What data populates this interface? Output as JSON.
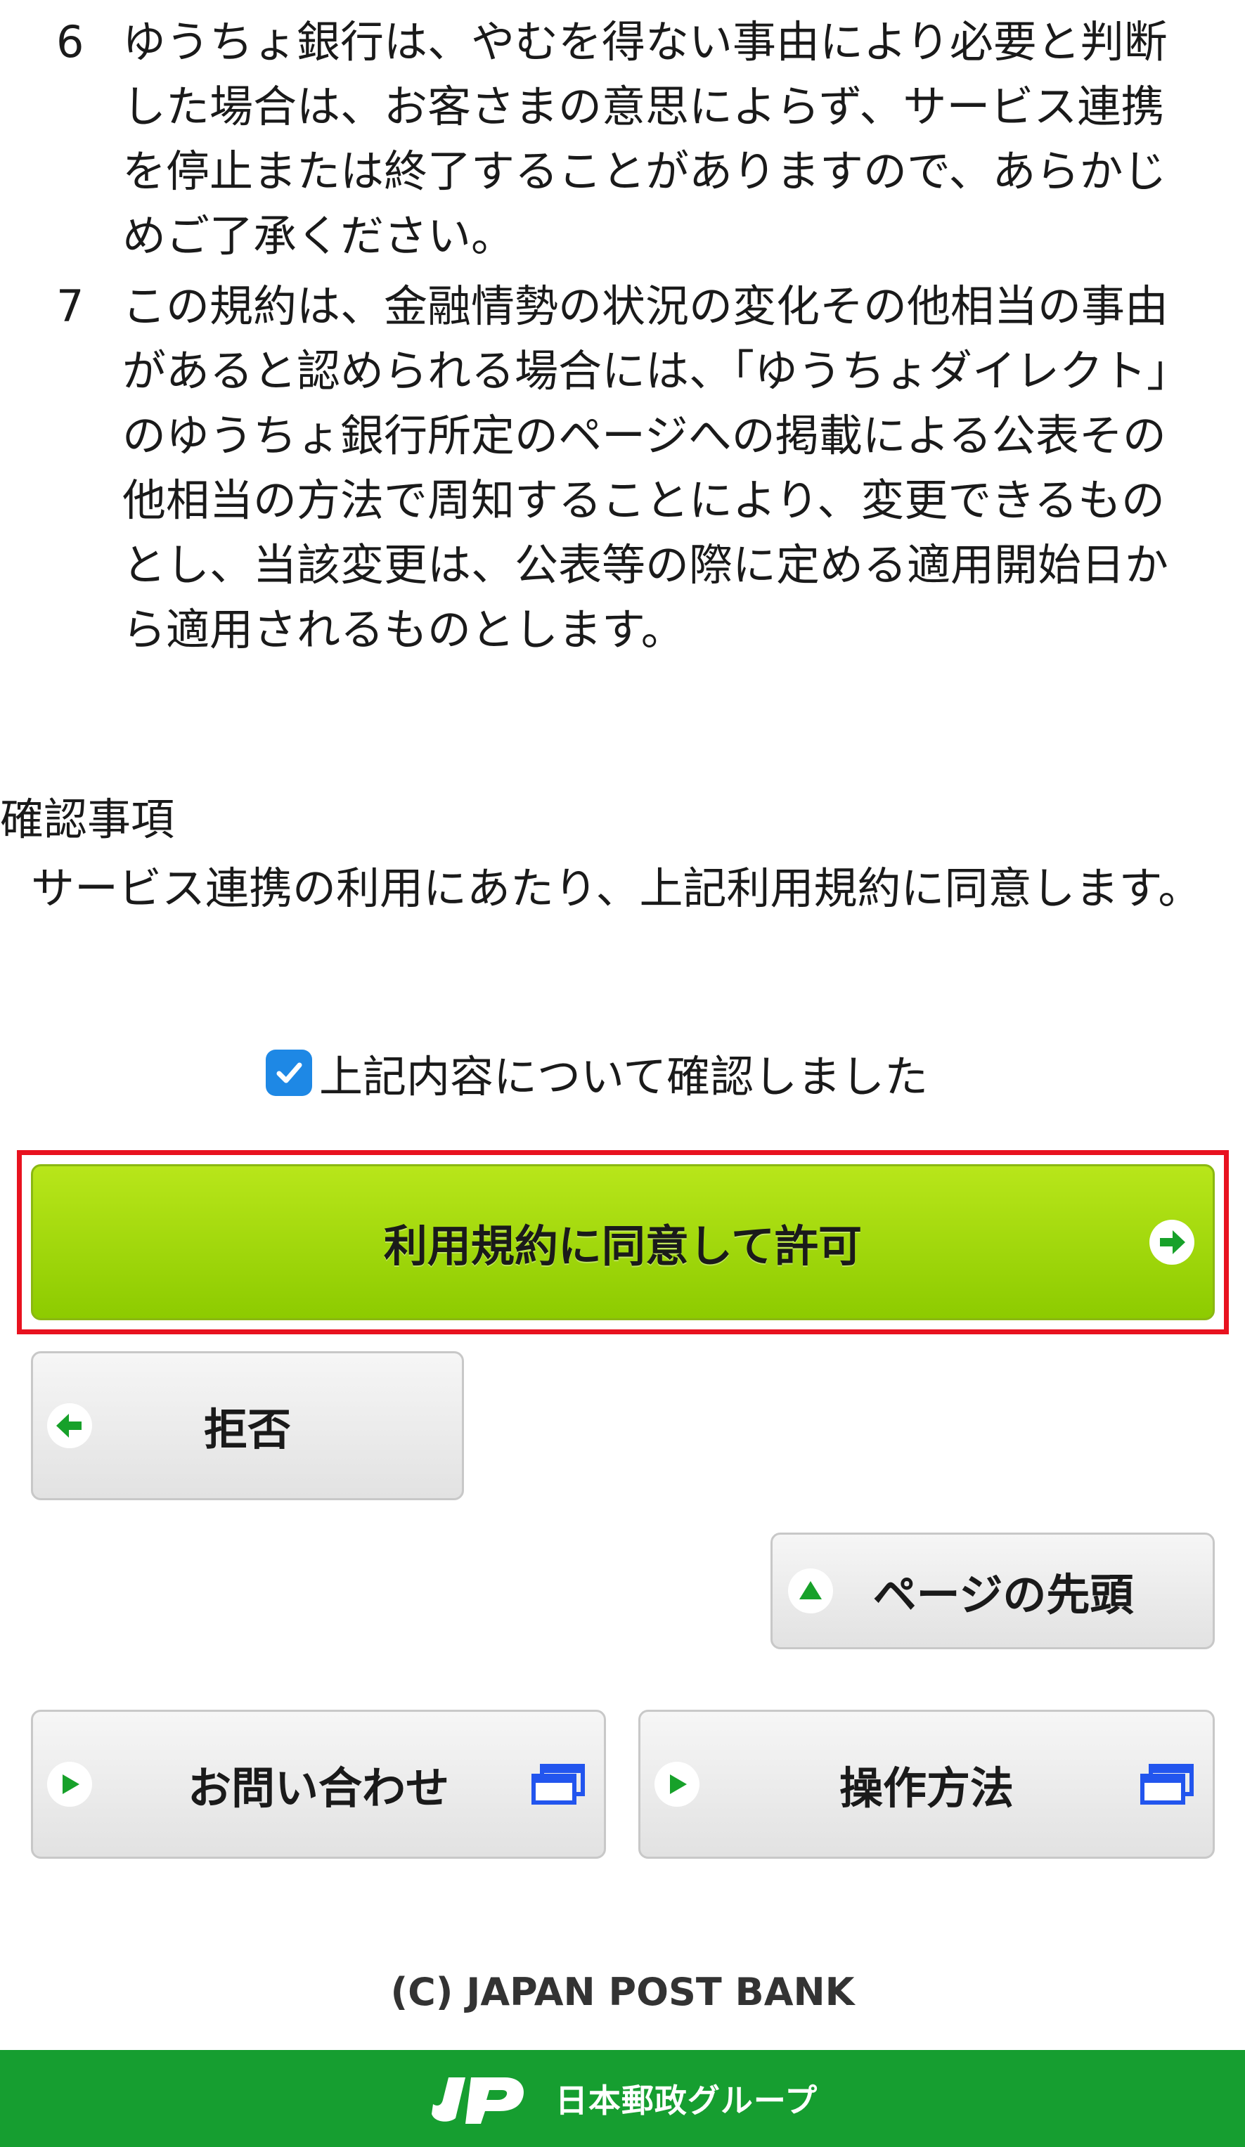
{
  "terms": [
    {
      "num": "6",
      "text": "ゆうちょ銀行は、やむを得ない事由により必要と判断した場合は、お客さまの意思によらず、サービス連携を停止または終了することがありますので、あらかじめご了承ください。"
    },
    {
      "num": "7",
      "text": "この規約は、金融情勢の状況の変化その他相当の事由があると認められる場合には、「ゆうちょダイレクト」のゆうちょ銀行所定のページへの掲載による公表その他相当の方法で周知することにより、変更できるものとし、当該変更は、公表等の際に定める適用開始日から適用されるものとします。"
    }
  ],
  "confirm": {
    "heading": "確認事項",
    "text": "サービス連携の利用にあたり、上記利用規約に同意します。",
    "checkbox_label": "上記内容について確認しました",
    "checked": true
  },
  "buttons": {
    "agree": "利用規約に同意して許可",
    "reject": "拒否",
    "page_top": "ページの先頭",
    "contact": "お問い合わせ",
    "howto": "操作方法"
  },
  "footer": {
    "copyright": "(C) JAPAN POST BANK",
    "group_name": "日本郵政グループ"
  },
  "colors": {
    "agree_green": "#9ad80a",
    "highlight_red": "#e8121f",
    "footer_green": "#169e30",
    "icon_green": "#17a12a",
    "check_blue": "#1e88e5",
    "window_icon_blue": "#2255ee"
  },
  "icons": {
    "agree": "arrow-right-circle-icon",
    "reject": "arrow-left-circle-icon",
    "page_top": "triangle-up-icon",
    "contact": "play-icon",
    "howto": "play-icon",
    "new_window": "new-window-icon"
  }
}
